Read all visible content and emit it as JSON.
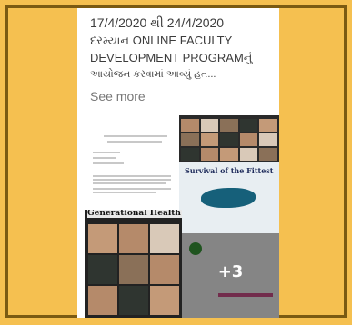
{
  "post": {
    "line1": "17/4/2020 થી 24/4/2020",
    "line2": "દરમ્યાન ONLINE FACULTY",
    "line3": "DEVELOPMENT PROGRAMનું",
    "line4": "આયોજન કરવામાં આવ્યું હત...",
    "see_more": "See more"
  },
  "gallery": {
    "thumb_survival_title": "Survival of the Fittest",
    "thumb_generational_title": "Generational Health Cas",
    "more_count_label": "+3"
  },
  "colors": {
    "background": "#f5c050",
    "border": "#7a5a12"
  }
}
